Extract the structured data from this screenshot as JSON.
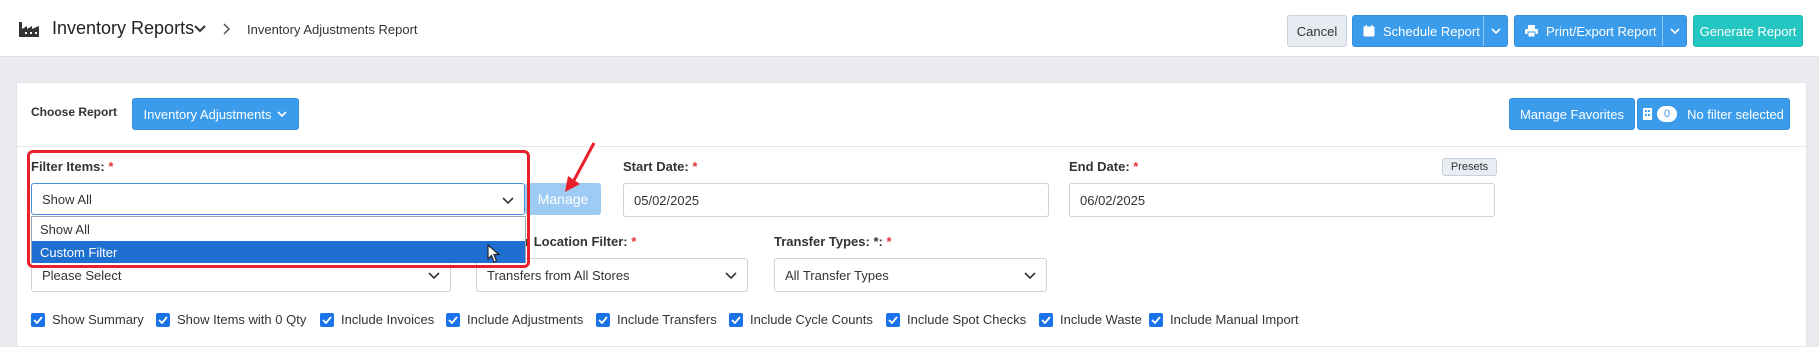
{
  "header": {
    "app_title": "Inventory Reports",
    "breadcrumb": "Inventory Adjustments Report",
    "cancel_label": "Cancel",
    "schedule_label": "Schedule Report",
    "print_label": "Print/Export Report",
    "generate_label": "Generate Report"
  },
  "report": {
    "choose_label": "Choose Report",
    "selected": "Inventory Adjustments",
    "manage_favorites": "Manage Favorites",
    "filter_count": "0",
    "filter_status": "No filter selected"
  },
  "filters": {
    "filter_items_label": "Filter Items:",
    "filter_items_value": "Show All",
    "filter_items_options": [
      "Show All",
      "Custom Filter"
    ],
    "manage_label": "Manage",
    "start_date_label": "Start Date:",
    "start_date_value": "05/02/2025",
    "end_date_label": "End Date:",
    "end_date_value": "06/02/2025",
    "presets_label": "Presets",
    "location_filter_label": "Location Filter:",
    "location_filter_partial": "r",
    "category_value": "Please Select",
    "location_value": "Transfers from All Stores",
    "transfer_types_label": "Transfer Types: *:",
    "transfer_types_value": "All Transfer Types",
    "required_mark": "*"
  },
  "checkboxes": [
    {
      "label": "Show Summary",
      "checked": true
    },
    {
      "label": "Show Items with 0 Qty",
      "checked": true
    },
    {
      "label": "Include Invoices",
      "checked": true
    },
    {
      "label": "Include Adjustments",
      "checked": true
    },
    {
      "label": "Include Transfers",
      "checked": true
    },
    {
      "label": "Include Cycle Counts",
      "checked": true
    },
    {
      "label": "Include Spot Checks",
      "checked": true
    },
    {
      "label": "Include Waste",
      "checked": true
    },
    {
      "label": "Include Manual Import",
      "checked": true
    }
  ],
  "colors": {
    "primary_blue": "#3b9cec",
    "teal": "#23c6c0",
    "highlight_red": "#e8202a",
    "selected_option": "#1f6fd1"
  },
  "icons": {
    "app": "factory-icon",
    "schedule": "calendar-icon",
    "print": "printer-icon",
    "filter": "building-icon"
  }
}
